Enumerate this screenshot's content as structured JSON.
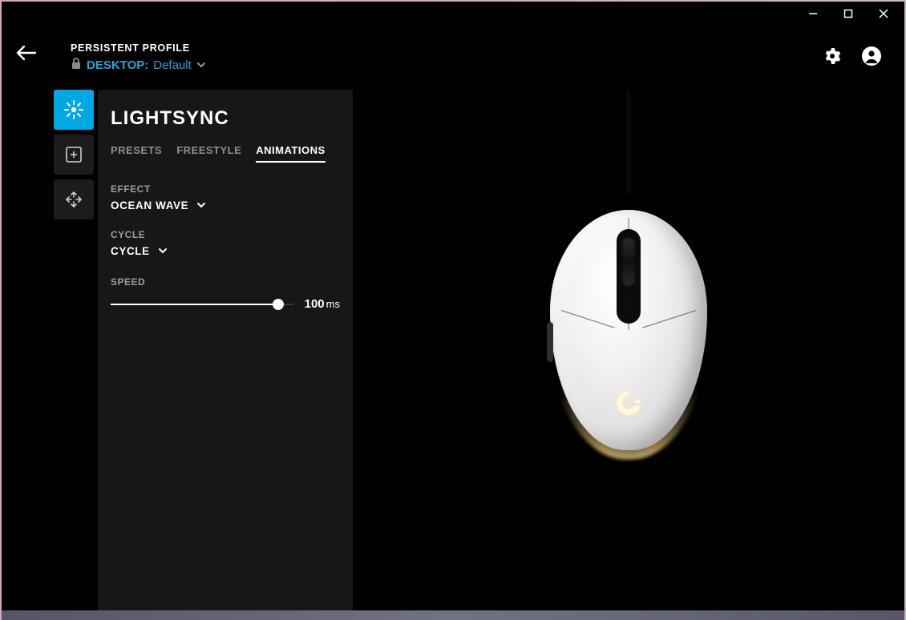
{
  "header": {
    "persistent_label": "PERSISTENT PROFILE",
    "desktop_label": "DESKTOP:",
    "desktop_value": "Default"
  },
  "panel": {
    "title": "LIGHTSYNC",
    "tabs": {
      "presets": "PRESETS",
      "freestyle": "FREESTYLE",
      "animations": "ANIMATIONS"
    },
    "effect_label": "EFFECT",
    "effect_value": "OCEAN WAVE",
    "cycle_label": "CYCLE",
    "cycle_value": "CYCLE",
    "speed_label": "SPEED",
    "speed_value": "100",
    "speed_unit": "ms",
    "speed_percent": 92
  }
}
